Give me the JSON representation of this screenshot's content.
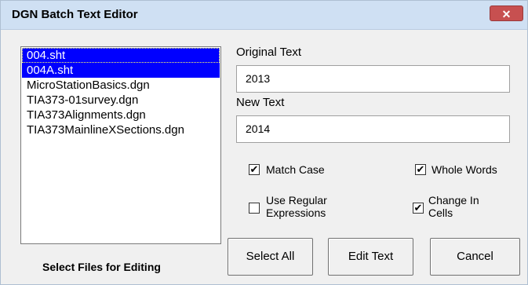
{
  "window": {
    "title": "DGN Batch Text Editor",
    "close_glyph": "✕"
  },
  "files": {
    "items": [
      {
        "label": "004.sht",
        "selected": true
      },
      {
        "label": "004A.sht",
        "selected": true
      },
      {
        "label": "MicroStationBasics.dgn",
        "selected": false
      },
      {
        "label": "TIA373-01survey.dgn",
        "selected": false
      },
      {
        "label": "TIA373Alignments.dgn",
        "selected": false
      },
      {
        "label": "TIA373MainlineXSections.dgn",
        "selected": false
      }
    ],
    "caption": "Select Files for Editing"
  },
  "original_text": {
    "label": "Original Text",
    "value": "2013"
  },
  "new_text": {
    "label": "New Text",
    "value": "2014"
  },
  "options": {
    "match_case": {
      "label": "Match Case",
      "checked": true
    },
    "whole_words": {
      "label": "Whole Words",
      "checked": true
    },
    "regex": {
      "label_line1": "Use Regular",
      "label_line2": "Expressions",
      "checked": false
    },
    "change_in_cells": {
      "label_line1": "Change In",
      "label_line2": "Cells",
      "checked": true
    }
  },
  "buttons": {
    "select_all": "Select All",
    "edit_text": "Edit Text",
    "cancel": "Cancel"
  },
  "colors": {
    "selection": "#0000ff",
    "titlebar": "#cfe0f3",
    "close": "#c75050"
  },
  "check_glyph": "✔"
}
